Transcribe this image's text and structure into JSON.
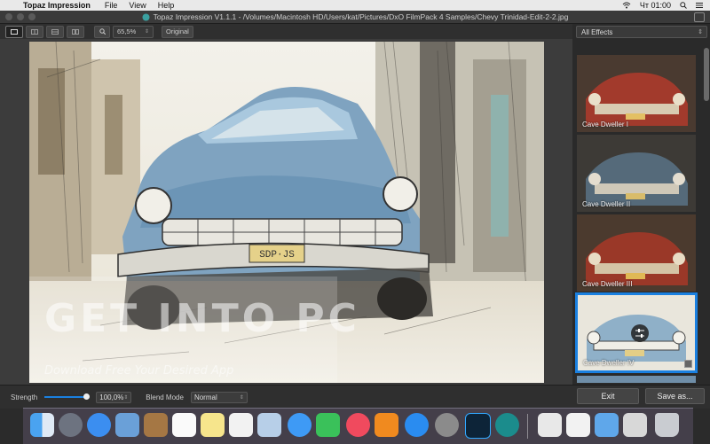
{
  "menubar": {
    "app": "Topaz Impression",
    "items": [
      "File",
      "View",
      "Help"
    ],
    "clock": "Чт 01:00"
  },
  "window": {
    "title": "Topaz Impression V1.1.1 - /Volumes/Macintosh HD/Users/kat/Pictures/DxO FilmPack 4 Samples/Chevy Trinidad-Edit-2-2.jpg"
  },
  "toolbar": {
    "zoom_value": "65,5%",
    "original_label": "Original"
  },
  "sidebar": {
    "filter_value": "All Effects",
    "effects": [
      {
        "label": "Cave Dweller I",
        "selected": false
      },
      {
        "label": "Cave Dweller II",
        "selected": false
      },
      {
        "label": "Cave Dweller III",
        "selected": false
      },
      {
        "label": "Cave Dweller IV",
        "selected": true
      }
    ]
  },
  "bottom": {
    "strength_label": "Strength",
    "strength_value": "100,0%",
    "strength_fraction": 1.0,
    "blend_label": "Blend Mode",
    "blend_value": "Normal",
    "exit_label": "Exit",
    "save_label": "Save as..."
  },
  "photo": {
    "plate": "SDP·JS",
    "watermark_big": "GET INTO PC",
    "watermark_small": "Download Free Your Desired App"
  },
  "colors": {
    "accent": "#1a80e0",
    "panel": "#2b2b2b"
  }
}
